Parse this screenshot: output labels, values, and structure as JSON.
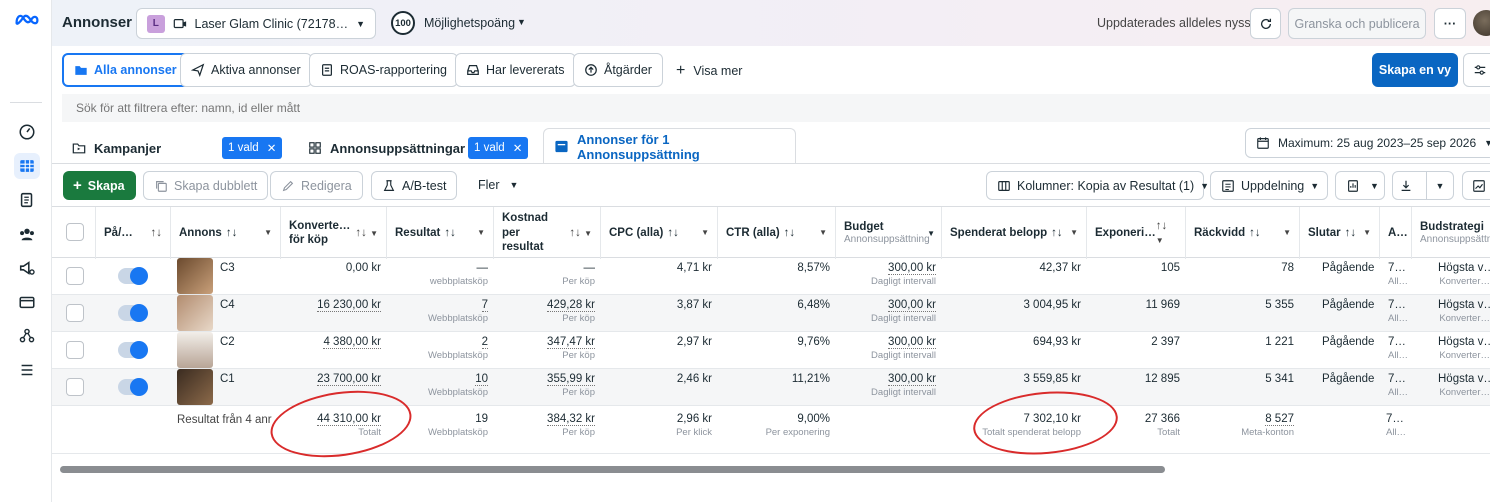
{
  "app": {
    "title": "Annonser",
    "brand_icon": "meta-logo-icon"
  },
  "account": {
    "initial": "L",
    "name": "Laser Glam Clinic (72178…",
    "score": "100",
    "score_label": "Möjlighetspoäng"
  },
  "header": {
    "status": "Uppdaterades alldeles nyss",
    "review_publish": "Granska och publicera",
    "more": "···"
  },
  "viewtabs": [
    "Alla annonser",
    "Aktiva annonser",
    "ROAS-rapportering",
    "Har levererats",
    "Åtgärder"
  ],
  "show_more": "Visa mer",
  "create_view": "Skapa en vy",
  "search": {
    "placeholder": "Sök för att filtrera efter: namn, id eller mått"
  },
  "levels": {
    "campaigns": "Kampanjer",
    "adsets": "Annonsuppsättningar",
    "ads": "Annonser för 1 Annonsuppsättning",
    "chip1": "1 vald",
    "chip2": "1 vald"
  },
  "date_range": "Maximum: 25 aug 2023–25 sep 2026",
  "toolbar": {
    "create": "Skapa",
    "duplicate": "Skapa dubblett",
    "edit": "Redigera",
    "ab_test": "A/B-test",
    "more": "Fler",
    "columns": "Kolumner: Kopia av Resultat (1)",
    "breakdown": "Uppdelning"
  },
  "columns": [
    {
      "name": "På/…",
      "sub": ""
    },
    {
      "name": "Annons",
      "sub": ""
    },
    {
      "name": "Konverte… för köp",
      "sub": ""
    },
    {
      "name": "Resultat",
      "sub": ""
    },
    {
      "name": "Kostnad per resultat",
      "sub": ""
    },
    {
      "name": "CPC (alla)",
      "sub": ""
    },
    {
      "name": "CTR (alla)",
      "sub": ""
    },
    {
      "name": "Budget",
      "sub": "Annonsuppsättning"
    },
    {
      "name": "Spenderat belopp",
      "sub": ""
    },
    {
      "name": "Exponeri…",
      "sub": ""
    },
    {
      "name": "Räckvidd",
      "sub": ""
    },
    {
      "name": "Slutar",
      "sub": ""
    },
    {
      "name": "A…",
      "sub": ""
    },
    {
      "name": "Budstrategi",
      "sub": "Annonsuppsättni…"
    }
  ],
  "rows": [
    {
      "name": "C3",
      "conv": "0,00 kr",
      "res": "—",
      "res_sub": "webbplatsköp",
      "cost": "—",
      "cost_sub": "Per köp",
      "cpc": "4,71 kr",
      "ctr": "8,57%",
      "budget": "300,00 kr",
      "budget_sub": "Dagligt intervall",
      "spent": "42,37 kr",
      "impr": "105",
      "reach": "78",
      "ends": "Pågående",
      "attr": "7…",
      "attr_sub": "All…",
      "bid": "Högsta v…",
      "bid_sub": "Konverter…"
    },
    {
      "name": "C4",
      "conv": "16 230,00 kr",
      "res": "7",
      "res_sub": "Webbplatsköp",
      "cost": "429,28 kr",
      "cost_sub": "Per köp",
      "cpc": "3,87 kr",
      "ctr": "6,48%",
      "budget": "300,00 kr",
      "budget_sub": "Dagligt intervall",
      "spent": "3 004,95 kr",
      "impr": "11 969",
      "reach": "5 355",
      "ends": "Pågående",
      "attr": "7…",
      "attr_sub": "All…",
      "bid": "Högsta v…",
      "bid_sub": "Konverter…"
    },
    {
      "name": "C2",
      "conv": "4 380,00 kr",
      "res": "2",
      "res_sub": "Webbplatsköp",
      "cost": "347,47 kr",
      "cost_sub": "Per köp",
      "cpc": "2,97 kr",
      "ctr": "9,76%",
      "budget": "300,00 kr",
      "budget_sub": "Dagligt intervall",
      "spent": "694,93 kr",
      "impr": "2 397",
      "reach": "1 221",
      "ends": "Pågående",
      "attr": "7…",
      "attr_sub": "All…",
      "bid": "Högsta v…",
      "bid_sub": "Konverter…"
    },
    {
      "name": "C1",
      "conv": "23 700,00 kr",
      "res": "10",
      "res_sub": "Webbplatsköp",
      "cost": "355,99 kr",
      "cost_sub": "Per köp",
      "cpc": "2,46 kr",
      "ctr": "11,21%",
      "budget": "300,00 kr",
      "budget_sub": "Dagligt intervall",
      "spent": "3 559,85 kr",
      "impr": "12 895",
      "reach": "5 341",
      "ends": "Pågående",
      "attr": "7…",
      "attr_sub": "All…",
      "bid": "Högsta v…",
      "bid_sub": "Konverter…"
    }
  ],
  "totals": {
    "label": "Resultat från 4 anr",
    "conv": "44 310,00 kr",
    "conv_sub": "Totalt",
    "res": "19",
    "res_sub": "Webbplatsköp",
    "cost": "384,32 kr",
    "cost_sub": "Per köp",
    "cpc": "2,96 kr",
    "cpc_sub": "Per klick",
    "ctr": "9,00%",
    "ctr_sub": "Per exponering",
    "spent": "7 302,10 kr",
    "spent_sub": "Totalt spenderat belopp",
    "impr": "27 366",
    "impr_sub": "Totalt",
    "reach": "8 527",
    "reach_sub": "Meta-konton",
    "attr": "7…",
    "attr_sub": "All…"
  },
  "colors": {
    "primary": "#1877f2",
    "create": "#1a7a3e",
    "annotation": "#d92b2b"
  }
}
